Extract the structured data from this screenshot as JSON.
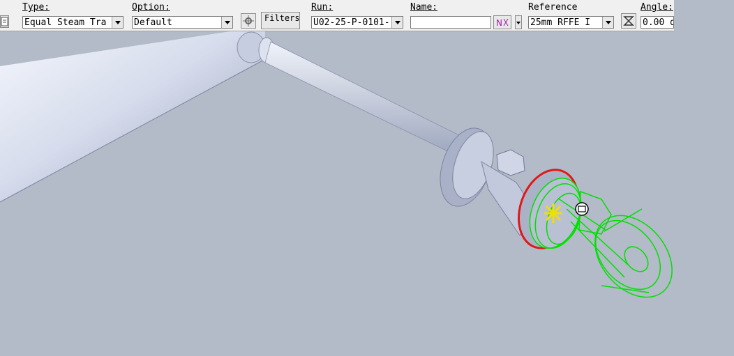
{
  "toolbar": {
    "type_label": "Type:",
    "type_value": "Equal Steam Tra",
    "option_label": "Option:",
    "option_value": "Default",
    "filters_label": "Filters",
    "run_label": "Run:",
    "run_value": "U02-25-P-0101-",
    "name_label": "Name:",
    "name_value": "",
    "reference_label": "Reference",
    "reference_value": "25mm  RFFE  I",
    "angle_label": "Angle:",
    "angle_value": "0.00 d"
  },
  "icons": {
    "left_edge": "document-icon",
    "component_picker": "component-icon",
    "name_picker": "name-generator-icon",
    "reference_picker": "reference-point-icon"
  },
  "colors": {
    "viewport_bg": "#b3bac8",
    "selection_red": "#e01818",
    "preview_green": "#00e000",
    "origin_yellow": "#f0e000"
  }
}
